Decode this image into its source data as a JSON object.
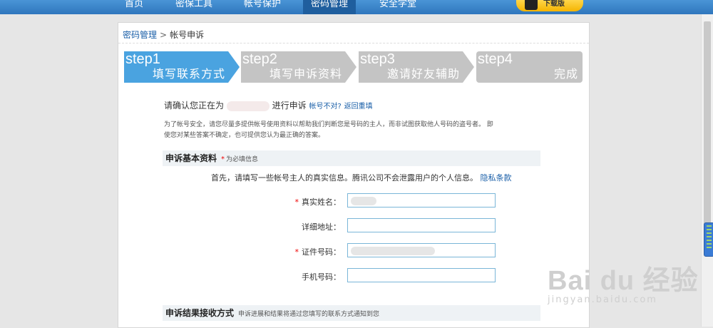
{
  "nav": {
    "items": [
      "首页",
      "密保工具",
      "帐号保护",
      "密码管理",
      "安全学堂"
    ],
    "active_index": 3,
    "promo_text": "下载版"
  },
  "breadcrumb": {
    "parent": "密码管理",
    "separator": ">",
    "current": "帐号申诉"
  },
  "steps": [
    {
      "number": "step1",
      "label": "填写联系方式",
      "state": "active",
      "color": "#4aa3e0"
    },
    {
      "number": "step2",
      "label": "填写申诉资料",
      "state": "inactive",
      "color": "#c4c4c4"
    },
    {
      "number": "step3",
      "label": "邀请好友辅助",
      "state": "inactive",
      "color": "#c4c4c4"
    },
    {
      "number": "step4",
      "label": "完成",
      "state": "inactive",
      "color": "#c4c4c4"
    }
  ],
  "confirm": {
    "prefix": "请确认您正在为",
    "suffix": "进行申诉",
    "wrong_link": "帐号不对?",
    "reset_link": "返回重填"
  },
  "notice": "为了帐号安全，请您尽量多提供帐号使用资料以帮助我们判断您是号码的主人，而非试图获取他人号码的盗号者。 即使您对某些答案不确定，也可提供您认为最正确的答案。",
  "section_basic": {
    "title": "申诉基本资料",
    "required_mark": "*",
    "hint": "为必填信息"
  },
  "intro": {
    "text": "首先，请填写一些帐号主人的真实信息。腾讯公司不会泄露用户的个人信息。",
    "link": "隐私条款"
  },
  "form": [
    {
      "label": "真实姓名：",
      "required": true,
      "value": ""
    },
    {
      "label": "详细地址：",
      "required": false,
      "value": ""
    },
    {
      "label": "证件号码：",
      "required": true,
      "value": ""
    },
    {
      "label": "手机号码：",
      "required": false,
      "value": ""
    }
  ],
  "section_result": {
    "title": "申诉结果接收方式",
    "hint": "申诉进展和结果将通过您填写的联系方式通知到您"
  },
  "watermark": {
    "main": "Bai du 经验",
    "sub": "jingyan.baidu.com"
  }
}
